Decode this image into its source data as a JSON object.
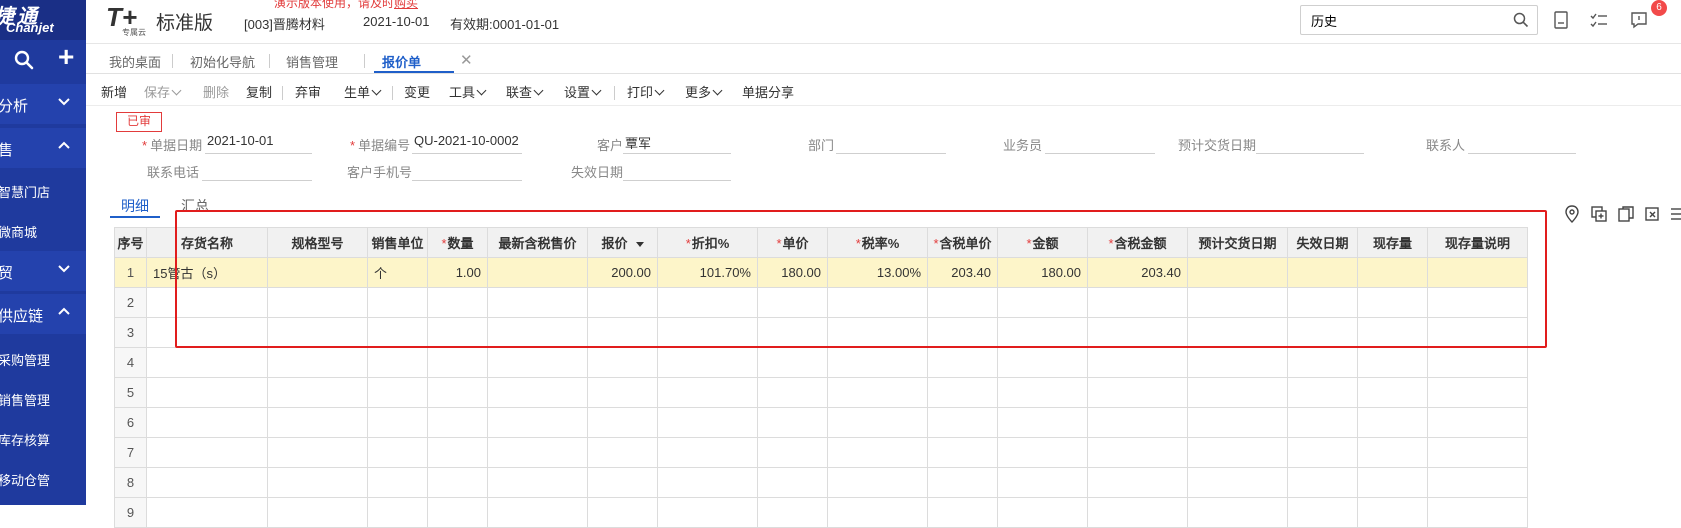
{
  "sidebar": {
    "brand_cn": "捷通",
    "brand_en": "Chanjet",
    "search_icon": "search-icon",
    "add_icon": "plus-icon",
    "items": [
      {
        "label": "分析",
        "expanded": false
      },
      {
        "label": "售",
        "expanded": true
      },
      {
        "label": "智慧门店"
      },
      {
        "label": "微商城"
      },
      {
        "label": "贸",
        "expanded": false
      },
      {
        "label": "供应链",
        "expanded": true
      },
      {
        "label": "采购管理"
      },
      {
        "label": "销售管理"
      },
      {
        "label": "库存核算"
      },
      {
        "label": "移动仓管"
      }
    ]
  },
  "header": {
    "logo": "T+",
    "logo_sub": "专属云",
    "edition": "标准版",
    "demo_notice": "演示版本使用，请及时",
    "demo_link": "购买",
    "company": "[003]晋腾材料",
    "login_date": "2021-10-01",
    "valid_until": "有效期:0001-01-01",
    "search_value": "历史",
    "notification_count": "6"
  },
  "tabs": [
    {
      "label": "我的桌面",
      "active": false
    },
    {
      "label": "初始化导航",
      "active": false
    },
    {
      "label": "销售管理",
      "active": false
    },
    {
      "label": "报价单",
      "active": true
    }
  ],
  "toolbar": [
    {
      "label": "新增",
      "enabled": true,
      "dropdown": false
    },
    {
      "label": "保存",
      "enabled": false,
      "dropdown": true
    },
    {
      "label": "删除",
      "enabled": false,
      "dropdown": false
    },
    {
      "label": "复制",
      "enabled": true,
      "dropdown": false
    },
    {
      "label": "弃审",
      "enabled": true,
      "dropdown": false
    },
    {
      "label": "生单",
      "enabled": true,
      "dropdown": true
    },
    {
      "label": "变更",
      "enabled": true,
      "dropdown": false
    },
    {
      "label": "工具",
      "enabled": true,
      "dropdown": true
    },
    {
      "label": "联查",
      "enabled": true,
      "dropdown": true
    },
    {
      "label": "设置",
      "enabled": true,
      "dropdown": true
    },
    {
      "label": "打印",
      "enabled": true,
      "dropdown": true
    },
    {
      "label": "更多",
      "enabled": true,
      "dropdown": true
    },
    {
      "label": "单据分享",
      "enabled": true,
      "dropdown": false
    }
  ],
  "status_stamp": "已审",
  "form": {
    "doc_date": {
      "label": "单据日期",
      "value": "2021-10-01",
      "required": true
    },
    "doc_no": {
      "label": "单据编号",
      "value": "QU-2021-10-0002",
      "required": true
    },
    "customer": {
      "label": "客户",
      "value": "覃军"
    },
    "department": {
      "label": "部门",
      "value": ""
    },
    "salesperson": {
      "label": "业务员",
      "value": ""
    },
    "expected_delivery": {
      "label": "预计交货日期",
      "value": ""
    },
    "contact": {
      "label": "联系人",
      "value": ""
    },
    "phone": {
      "label": "联系电话",
      "value": ""
    },
    "customer_mobile": {
      "label": "客户手机号",
      "value": ""
    },
    "expiry_date": {
      "label": "失效日期",
      "value": ""
    }
  },
  "subtabs": {
    "detail": "明细",
    "summary": "汇总"
  },
  "right_icons": [
    "location-icon",
    "add-row-icon",
    "copy-row-icon",
    "delete-row-icon",
    "column-settings-icon"
  ],
  "grid": {
    "columns": [
      {
        "label": "序号",
        "required": false
      },
      {
        "label": "存货名称",
        "required": false
      },
      {
        "label": "规格型号",
        "required": false
      },
      {
        "label": "销售单位",
        "required": false
      },
      {
        "label": "数量",
        "required": true
      },
      {
        "label": "最新含税售价",
        "required": false
      },
      {
        "label": "报价",
        "required": false,
        "sortable": true
      },
      {
        "label": "折扣%",
        "required": true
      },
      {
        "label": "单价",
        "required": true
      },
      {
        "label": "税率%",
        "required": true
      },
      {
        "label": "含税单价",
        "required": true
      },
      {
        "label": "金额",
        "required": true
      },
      {
        "label": "含税金额",
        "required": true
      },
      {
        "label": "预计交货日期",
        "required": false
      },
      {
        "label": "失效日期",
        "required": false
      },
      {
        "label": "现存量",
        "required": false
      },
      {
        "label": "现存量说明",
        "required": false
      }
    ],
    "rows": [
      {
        "index": "1",
        "cells": [
          "15管古（s）",
          "",
          "个",
          "1.00",
          "",
          "200.00",
          "101.70%",
          "180.00",
          "13.00%",
          "203.40",
          "180.00",
          "203.40",
          "",
          "",
          "",
          ""
        ]
      },
      {
        "index": "2",
        "cells": [
          "",
          "",
          "",
          "",
          "",
          "",
          "",
          "",
          "",
          "",
          "",
          "",
          "",
          "",
          "",
          ""
        ]
      },
      {
        "index": "3",
        "cells": [
          "",
          "",
          "",
          "",
          "",
          "",
          "",
          "",
          "",
          "",
          "",
          "",
          "",
          "",
          "",
          ""
        ]
      },
      {
        "index": "4",
        "cells": [
          "",
          "",
          "",
          "",
          "",
          "",
          "",
          "",
          "",
          "",
          "",
          "",
          "",
          "",
          "",
          ""
        ]
      },
      {
        "index": "5",
        "cells": [
          "",
          "",
          "",
          "",
          "",
          "",
          "",
          "",
          "",
          "",
          "",
          "",
          "",
          "",
          "",
          ""
        ]
      },
      {
        "index": "6",
        "cells": [
          "",
          "",
          "",
          "",
          "",
          "",
          "",
          "",
          "",
          "",
          "",
          "",
          "",
          "",
          "",
          ""
        ]
      },
      {
        "index": "7",
        "cells": [
          "",
          "",
          "",
          "",
          "",
          "",
          "",
          "",
          "",
          "",
          "",
          "",
          "",
          "",
          "",
          ""
        ]
      },
      {
        "index": "8",
        "cells": [
          "",
          "",
          "",
          "",
          "",
          "",
          "",
          "",
          "",
          "",
          "",
          "",
          "",
          "",
          "",
          ""
        ]
      },
      {
        "index": "9",
        "cells": [
          "",
          "",
          "",
          "",
          "",
          "",
          "",
          "",
          "",
          "",
          "",
          "",
          "",
          "",
          "",
          ""
        ]
      }
    ]
  },
  "colors": {
    "sidebar": "#1f3a9e",
    "accent": "#1f5fc9",
    "highlight_row": "#fdf5c9",
    "annotation_box": "#e11d1d",
    "required": "#e23b3b"
  }
}
